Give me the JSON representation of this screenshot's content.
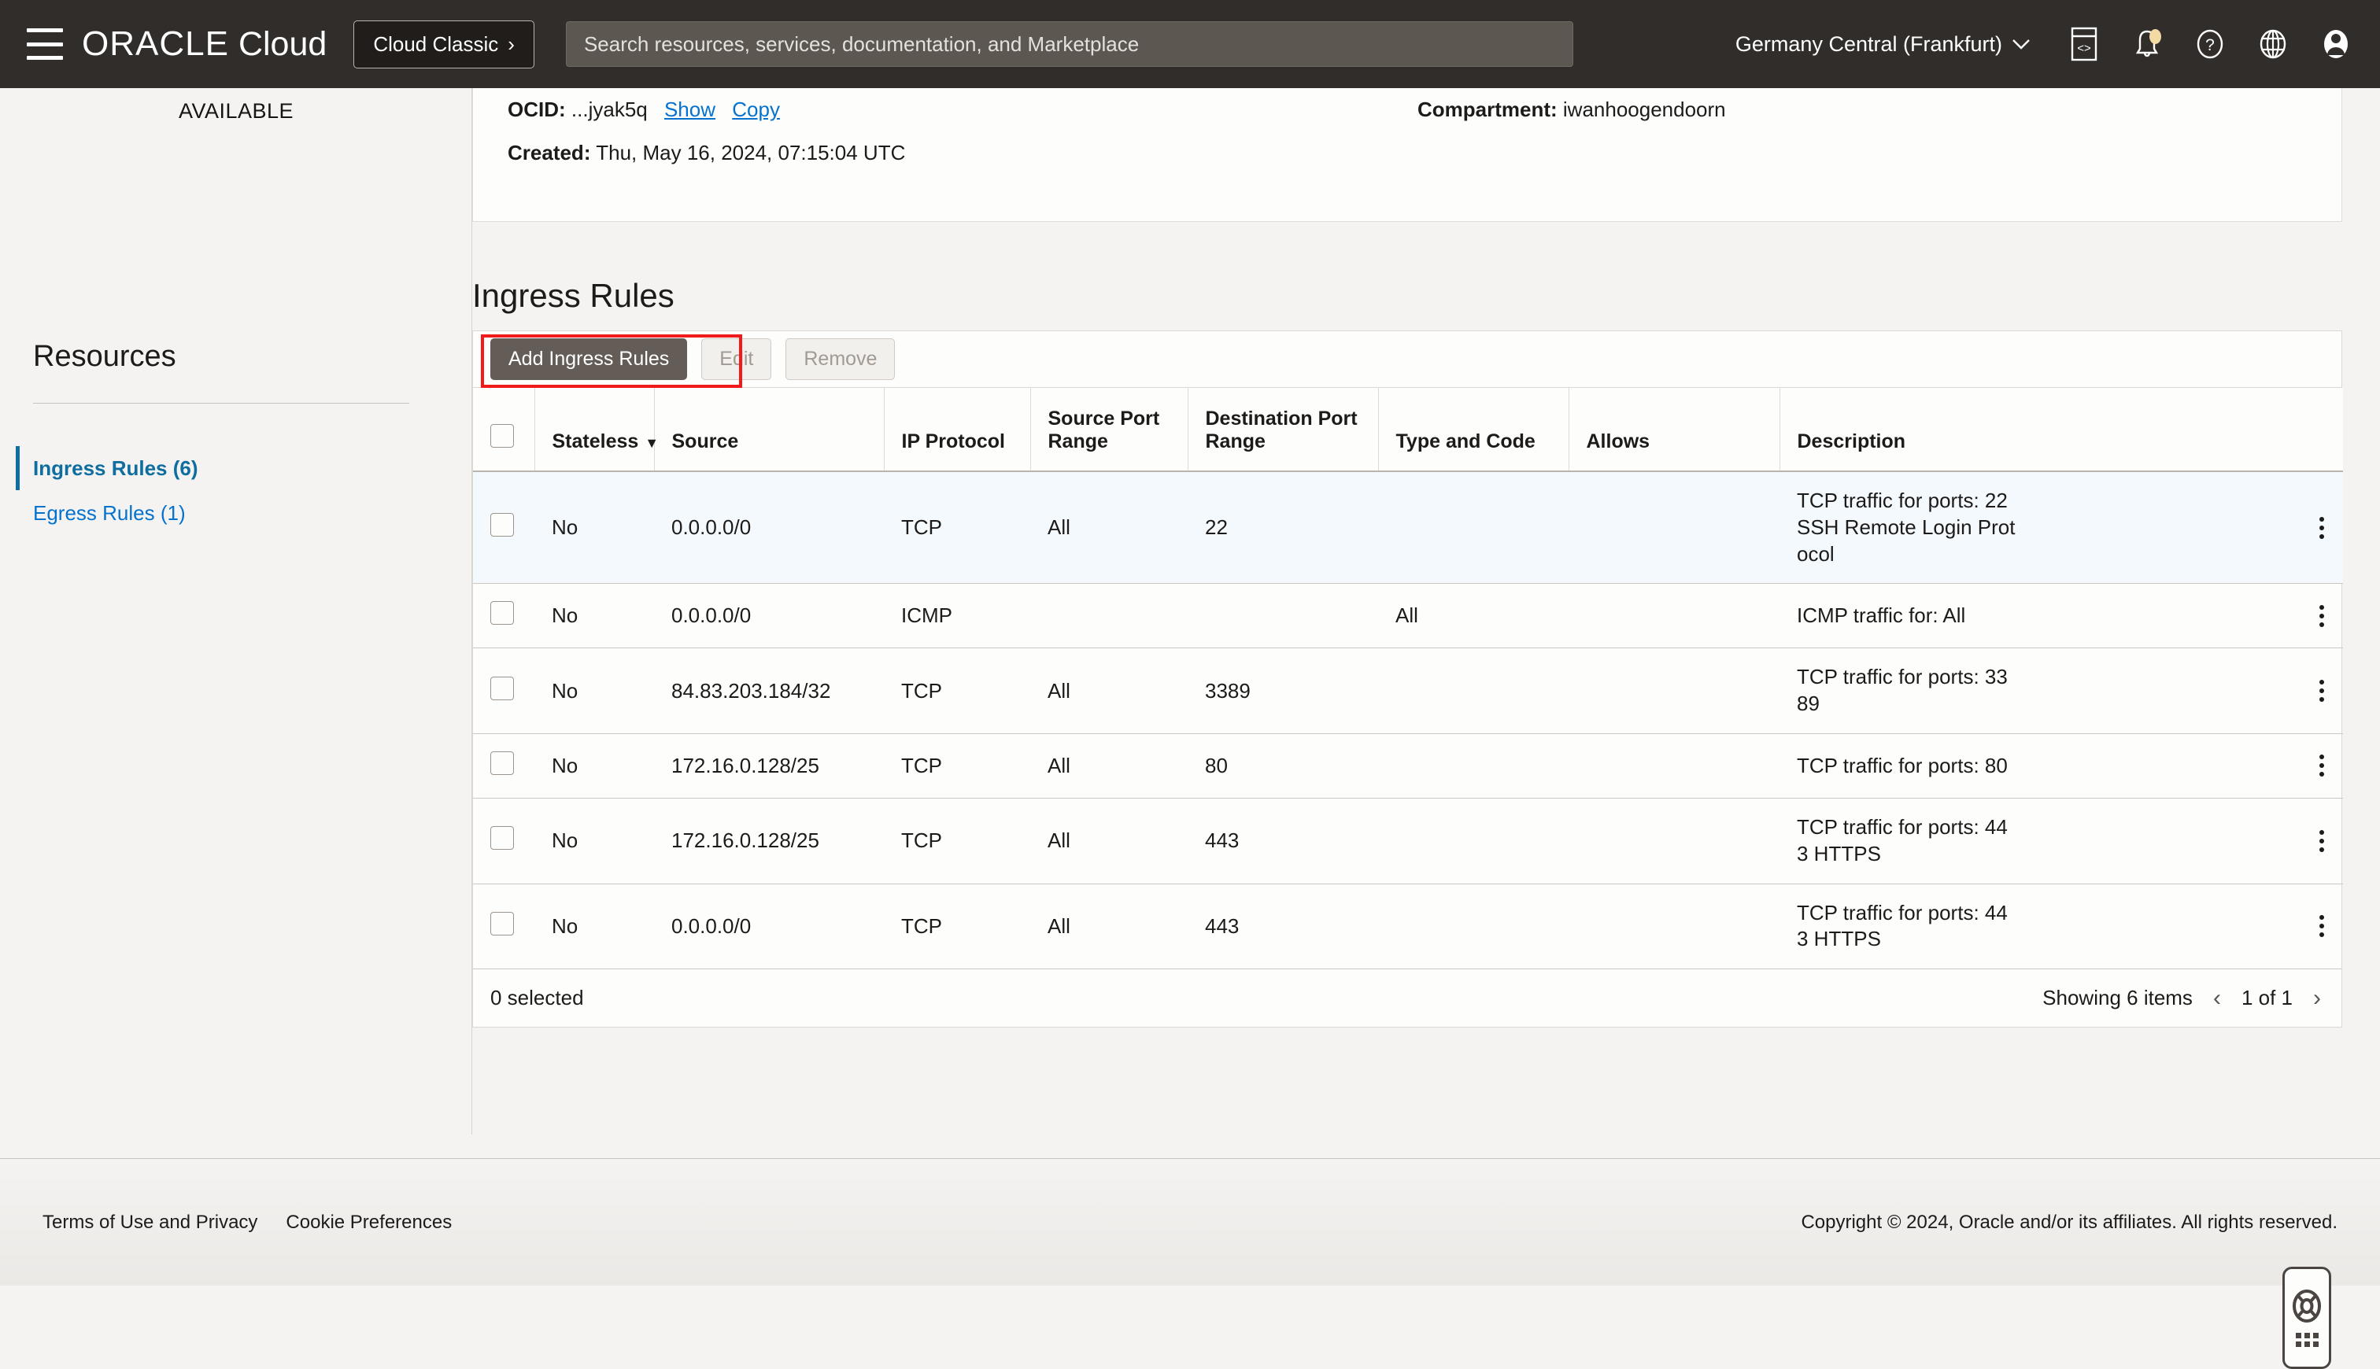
{
  "topbar": {
    "menu_icon": "hamburger-icon",
    "brand_oracle": "ORACLE",
    "brand_cloud": "Cloud",
    "cloud_classic_label": "Cloud Classic",
    "cloud_classic_chevron": "›",
    "search_placeholder": "Search resources, services, documentation, and Marketplace",
    "search_value": "",
    "region": "Germany Central (Frankfurt)",
    "region_chevron": "⌄",
    "icons": [
      "cloud-shell-icon",
      "notifications-bell-icon",
      "help-question-icon",
      "language-globe-icon",
      "user-avatar-icon"
    ],
    "bar_color": "#312d2a"
  },
  "sidebar": {
    "availability_status": "AVAILABLE",
    "heading": "Resources",
    "items": [
      {
        "label": "Ingress Rules (6)",
        "active": true
      },
      {
        "label": "Egress Rules (1)",
        "active": false
      }
    ],
    "link_color": "#0572ce",
    "active_color": "#0f6ea0"
  },
  "details": {
    "ocid_label": "OCID:",
    "ocid_value": "...jyak5q",
    "ocid_show": "Show",
    "ocid_copy": "Copy",
    "compartment_label": "Compartment:",
    "compartment_value": "iwanhoogendoorn",
    "created_label": "Created:",
    "created_value": "Thu, May 16, 2024, 07:15:04 UTC"
  },
  "section": {
    "title": "Ingress Rules"
  },
  "toolbar": {
    "add_label": "Add Ingress Rules",
    "edit_label": "Edit",
    "remove_label": "Remove",
    "highlight_color": "#f01a1a"
  },
  "table": {
    "columns": [
      "Stateless",
      "Source",
      "IP Protocol",
      "Source Port Range",
      "Destination Port Range",
      "Type and Code",
      "Allows",
      "Description"
    ],
    "sort_column": "Stateless",
    "sort_caret": "▼",
    "rows": [
      {
        "selected_highlight": true,
        "stateless": "No",
        "source": "0.0.0.0/0",
        "protocol": "TCP",
        "source_port_range": "All",
        "destination_port_range": "22",
        "type_and_code": "",
        "allows": "",
        "description": "TCP traffic for ports: 22\nSSH Remote Login Prot\nocol"
      },
      {
        "selected_highlight": false,
        "stateless": "No",
        "source": "0.0.0.0/0",
        "protocol": "ICMP",
        "source_port_range": "",
        "destination_port_range": "",
        "type_and_code": "All",
        "allows": "",
        "description": "ICMP traffic for: All"
      },
      {
        "selected_highlight": false,
        "stateless": "No",
        "source": "84.83.203.184/32",
        "protocol": "TCP",
        "source_port_range": "All",
        "destination_port_range": "3389",
        "type_and_code": "",
        "allows": "",
        "description": "TCP traffic for ports: 33\n89"
      },
      {
        "selected_highlight": false,
        "stateless": "No",
        "source": "172.16.0.128/25",
        "protocol": "TCP",
        "source_port_range": "All",
        "destination_port_range": "80",
        "type_and_code": "",
        "allows": "",
        "description": "TCP traffic for ports: 80"
      },
      {
        "selected_highlight": false,
        "stateless": "No",
        "source": "172.16.0.128/25",
        "protocol": "TCP",
        "source_port_range": "All",
        "destination_port_range": "443",
        "type_and_code": "",
        "allows": "",
        "description": "TCP traffic for ports: 44\n3 HTTPS"
      },
      {
        "selected_highlight": false,
        "stateless": "No",
        "source": "0.0.0.0/0",
        "protocol": "TCP",
        "source_port_range": "All",
        "destination_port_range": "443",
        "type_and_code": "",
        "allows": "",
        "description": "TCP traffic for ports: 44\n3 HTTPS"
      }
    ],
    "footer": {
      "selected_count": "0 selected",
      "showing": "Showing 6 items",
      "page_indicator": "1 of 1",
      "prev_arrow": "‹",
      "next_arrow": "›"
    }
  },
  "help_widget": {
    "icon": "lifebuoy-icon",
    "grid_icon": "dot-grid-icon"
  },
  "footer": {
    "links": [
      "Terms of Use and Privacy",
      "Cookie Preferences"
    ],
    "copyright": "Copyright © 2024, Oracle and/or its affiliates. All rights reserved."
  }
}
